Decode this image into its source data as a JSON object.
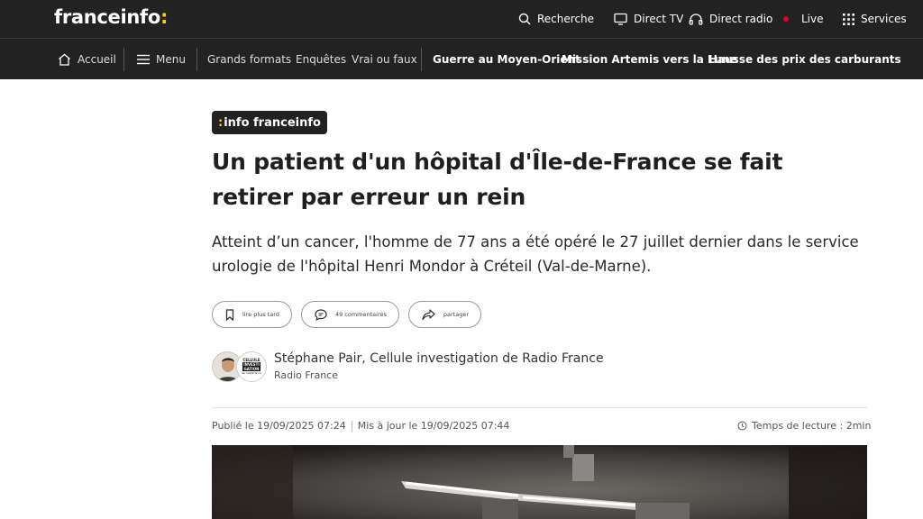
{
  "header": {
    "logo_text": "franceinfo",
    "logo_accent": ":",
    "nav": {
      "search": "Recherche",
      "direct_tv": "Direct TV",
      "direct_radio": "Direct radio",
      "live": "Live",
      "services": "Services"
    }
  },
  "subnav": {
    "home": "Accueil",
    "menu": "Menu",
    "links": [
      "Grands formats",
      "Enquêtes",
      "Vrai ou faux"
    ],
    "topics": [
      "Guerre au Moyen-Orient",
      "Mission Artemis vers la Lune",
      "Hausse des prix des carburants"
    ]
  },
  "article": {
    "badge_colon": ":",
    "badge_text": "info franceinfo",
    "title": "Un patient d'un hôpital d'Île-de-France se fait retirer par erreur un rein",
    "chapo": "Atteint d’un cancer, l'homme de 77 ans a été opéré le 27 juillet dernier dans le service urologie de l'hôpital Henri Mondor à Créteil (Val-de-Marne).",
    "actions": {
      "read_later": "lire plus tard",
      "comments": "49 commentaires",
      "share": "partager"
    },
    "author": "Stéphane Pair, Cellule investigation de Radio France",
    "author_org": "Radio France",
    "logo_lines": [
      "CELLULE",
      "INVESTI",
      "GATION",
      "de radiofrance"
    ],
    "published": "Publié le 19/09/2025 07:24",
    "updated": "Mis à jour le 19/09/2025 07:44",
    "reading_time": "Temps de lecture : 2min"
  },
  "colors": {
    "header_bg": "#222222",
    "accent_yellow": "#fecc01",
    "live_red": "#e4002b"
  }
}
